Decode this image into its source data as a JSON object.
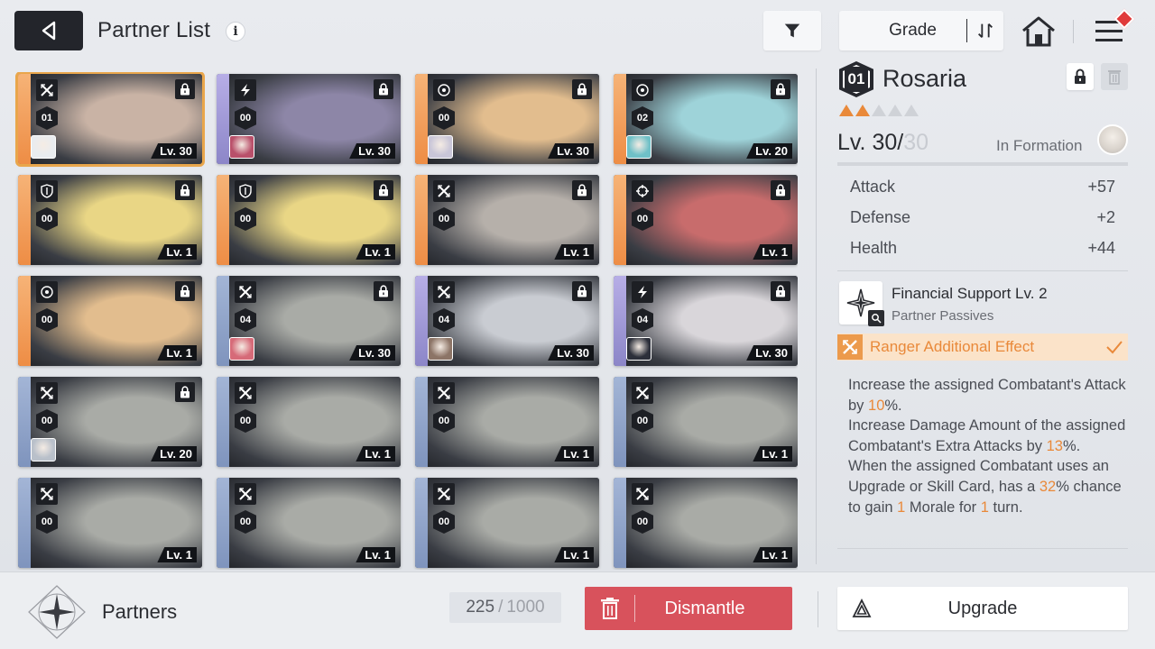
{
  "header": {
    "title": "Partner List",
    "info_glyph": "i",
    "sort_label": "Grade"
  },
  "colors": {
    "accent_orange": "#e9893a",
    "dismantle_red": "#d8525c",
    "selected_outline": "#e9a64b",
    "stripe_orange": "#f2a766",
    "stripe_purple": "#a7a0dc",
    "stripe_blue": "#8fa6cc"
  },
  "cards": [
    {
      "class_icon": "sword-cross-icon",
      "stage": "01",
      "level": "Lv. 30",
      "locked": true,
      "selected": true,
      "stripe": "orange",
      "art": "#c9b3a5",
      "combatant": "#e9ecef"
    },
    {
      "class_icon": "lightning-icon",
      "stage": "00",
      "level": "Lv. 30",
      "locked": true,
      "selected": false,
      "stripe": "purple",
      "art": "#8d86a7",
      "combatant": "#b9506a"
    },
    {
      "class_icon": "target-icon",
      "stage": "00",
      "level": "Lv. 30",
      "locked": true,
      "selected": false,
      "stripe": "orange",
      "art": "#e2bd8e",
      "combatant": "#c9c6d8"
    },
    {
      "class_icon": "target-icon",
      "stage": "02",
      "level": "Lv. 20",
      "locked": true,
      "selected": false,
      "stripe": "orange",
      "art": "#9ed3d9",
      "combatant": "#6fc0c7"
    },
    {
      "class_icon": "shield-icon",
      "stage": "00",
      "level": "Lv. 1",
      "locked": true,
      "selected": false,
      "stripe": "orange",
      "art": "#e9d685",
      "combatant": null
    },
    {
      "class_icon": "shield-icon",
      "stage": "00",
      "level": "Lv. 1",
      "locked": true,
      "selected": false,
      "stripe": "orange",
      "art": "#e9d685",
      "combatant": null
    },
    {
      "class_icon": "sword-cross-icon",
      "stage": "00",
      "level": "Lv. 1",
      "locked": true,
      "selected": false,
      "stripe": "orange",
      "art": "#b6b0aa",
      "combatant": null
    },
    {
      "class_icon": "crosshair-icon",
      "stage": "00",
      "level": "Lv. 1",
      "locked": true,
      "selected": false,
      "stripe": "orange",
      "art": "#c86c6c",
      "combatant": null
    },
    {
      "class_icon": "target-icon",
      "stage": "00",
      "level": "Lv. 1",
      "locked": true,
      "selected": false,
      "stripe": "orange",
      "art": "#e2bd8e",
      "combatant": null
    },
    {
      "class_icon": "sword-cross-icon",
      "stage": "04",
      "level": "Lv. 30",
      "locked": true,
      "selected": false,
      "stripe": "blue",
      "art": "#a9aba6",
      "combatant": "#d66a78"
    },
    {
      "class_icon": "sword-cross-icon",
      "stage": "04",
      "level": "Lv. 30",
      "locked": true,
      "selected": false,
      "stripe": "purple",
      "art": "#c9ccd2",
      "combatant": "#8c7466"
    },
    {
      "class_icon": "lightning-icon",
      "stage": "04",
      "level": "Lv. 30",
      "locked": true,
      "selected": false,
      "stripe": "purple",
      "art": "#d9d6da",
      "combatant": "#2c2f3a"
    },
    {
      "class_icon": "sword-cross-icon",
      "stage": "00",
      "level": "Lv. 20",
      "locked": true,
      "selected": false,
      "stripe": "blue",
      "art": "#a9aba6",
      "combatant": "#b9c0ca"
    },
    {
      "class_icon": "sword-cross-icon",
      "stage": "00",
      "level": "Lv. 1",
      "locked": false,
      "selected": false,
      "stripe": "blue",
      "art": "#a9aba6",
      "combatant": null
    },
    {
      "class_icon": "sword-cross-icon",
      "stage": "00",
      "level": "Lv. 1",
      "locked": false,
      "selected": false,
      "stripe": "blue",
      "art": "#a9aba6",
      "combatant": null
    },
    {
      "class_icon": "sword-cross-icon",
      "stage": "00",
      "level": "Lv. 1",
      "locked": false,
      "selected": false,
      "stripe": "blue",
      "art": "#a9aba6",
      "combatant": null
    },
    {
      "class_icon": "sword-cross-icon",
      "stage": "00",
      "level": "Lv. 1",
      "locked": false,
      "selected": false,
      "stripe": "blue",
      "art": "#a9aba6",
      "combatant": null
    },
    {
      "class_icon": "sword-cross-icon",
      "stage": "00",
      "level": "Lv. 1",
      "locked": false,
      "selected": false,
      "stripe": "blue",
      "art": "#a9aba6",
      "combatant": null
    },
    {
      "class_icon": "sword-cross-icon",
      "stage": "00",
      "level": "Lv. 1",
      "locked": false,
      "selected": false,
      "stripe": "blue",
      "art": "#a9aba6",
      "combatant": null
    },
    {
      "class_icon": "sword-cross-icon",
      "stage": "00",
      "level": "Lv. 1",
      "locked": false,
      "selected": false,
      "stripe": "blue",
      "art": "#a9aba6",
      "combatant": null
    }
  ],
  "detail": {
    "stage": "01",
    "name": "Rosaria",
    "grade_filled": 2,
    "grade_total": 5,
    "level_current": "Lv. 30/",
    "level_max": "30",
    "in_formation": "In Formation",
    "stats": [
      {
        "label": "Attack",
        "value": "+57"
      },
      {
        "label": "Defense",
        "value": "+2"
      },
      {
        "label": "Health",
        "value": "+44"
      }
    ],
    "skill_name": "Financial Support Lv. 2",
    "skill_sub": "Partner Passives",
    "effect_label": "Ranger Additional Effect",
    "desc": {
      "l1": "Increase the assigned Combatant's Attack by ",
      "v1": "10",
      "l1b": "%.",
      "l2": "Increase Damage Amount of the assigned Combatant's Extra Attacks by ",
      "v2": "13",
      "l2b": "%.",
      "l3": "When the assigned Combatant uses an Upgrade or Skill Card, has a ",
      "v3": "32",
      "l3b": "% chance to gain ",
      "v4": "1",
      "l3c": " Morale for ",
      "v5": "1",
      "l3d": " turn."
    }
  },
  "footer": {
    "section_label": "Partners",
    "count_current": "225",
    "count_sep": "/",
    "count_total": "1000",
    "dismantle_label": "Dismantle",
    "upgrade_label": "Upgrade"
  }
}
